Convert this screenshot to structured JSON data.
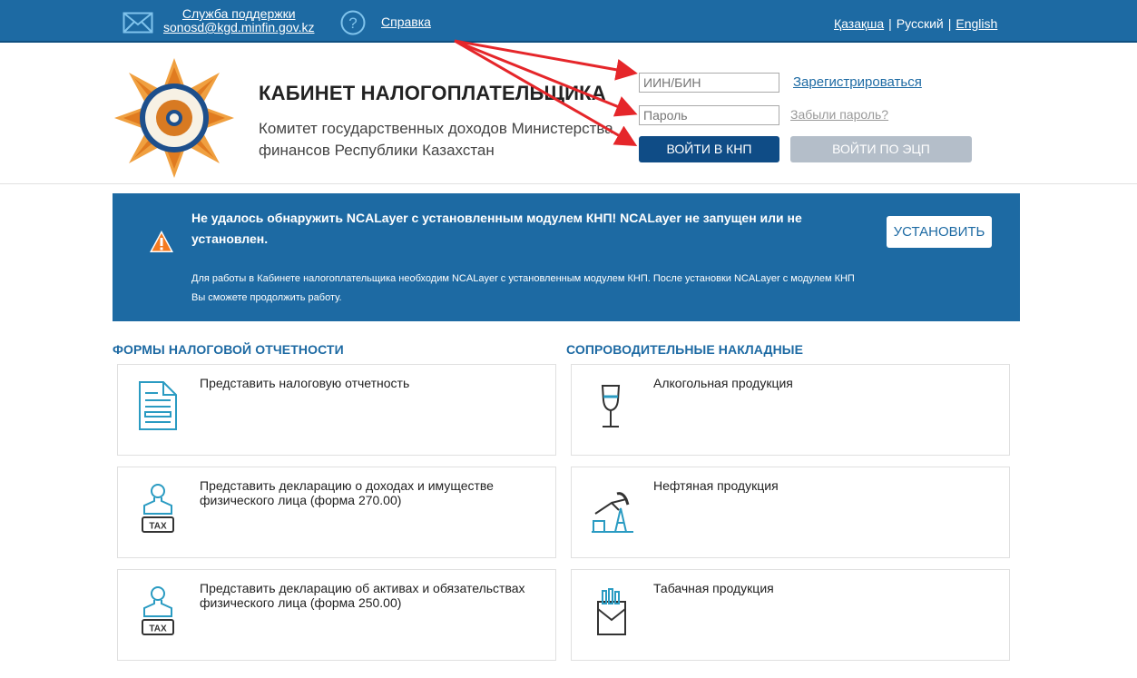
{
  "topbar": {
    "support_label": "Служба поддержки",
    "support_email": "sonosd@kgd.minfin.gov.kz",
    "help_label": "Справка",
    "languages": [
      "Қазақша",
      "Русский",
      "English"
    ]
  },
  "header": {
    "title": "КАБИНЕТ НАЛОГОПЛАТЕЛЬЩИКА",
    "subtitle": "Комитет государственных доходов Министерства финансов Республики Казахстан"
  },
  "login": {
    "iin_placeholder": "ИИН/БИН",
    "password_placeholder": "Пароль",
    "register_label": " Зарегистрироваться",
    "forgot_label": "Забыли пароль?",
    "login_button": "ВОЙТИ В КНП",
    "ecp_button": "ВОЙТИ ПО ЭЦП"
  },
  "notice": {
    "title": "Не удалось обнаружить NCALayer с установленным модулем КНП! NCALayer не запущен или не установлен.",
    "text": "Для работы в Кабинете налогоплательщика необходим NCALayer с установленным модулем КНП. После установки NCALayer с модулем КНП Вы сможете продолжить работу.",
    "install_button": "УСТАНОВИТЬ"
  },
  "tax_forms": {
    "title": "ФОРМЫ НАЛОГОВОЙ ОТЧЕТНОСТИ",
    "items": [
      {
        "label": "Представить налоговую отчетность",
        "icon": "document-icon"
      },
      {
        "label": "Представить декларацию о доходах и имуществе физического лица (форма 270.00)",
        "icon": "person-tax-icon"
      },
      {
        "label": "Представить декларацию об активах и обязательствах физического лица (форма 250.00)",
        "icon": "person-tax-icon"
      }
    ]
  },
  "waybills": {
    "title": "СОПРОВОДИТЕЛЬНЫЕ НАКЛАДНЫЕ",
    "items": [
      {
        "label": "Алкогольная продукция",
        "icon": "wine-glass-icon"
      },
      {
        "label": "Нефтяная продукция",
        "icon": "oil-pump-icon"
      },
      {
        "label": "Табачная продукция",
        "icon": "cigarette-pack-icon"
      }
    ]
  },
  "tax_badge_text": "TAX",
  "colors": {
    "brand_blue": "#1d6aa3",
    "dark_blue": "#0f4c86",
    "disabled_button": "#b4bec9",
    "arrow_red": "#e5262a",
    "logo_orange": "#e98b2c",
    "icon_teal": "#2a9bc2"
  }
}
